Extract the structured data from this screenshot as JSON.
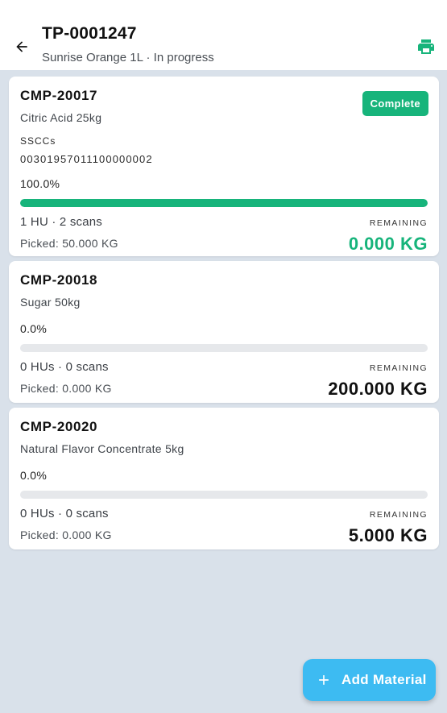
{
  "header": {
    "title": "TP-0001247",
    "subtitle": "Sunrise Orange 1L · In progress",
    "back_icon": "arrow-left-icon",
    "print_icon": "printer-icon"
  },
  "colors": {
    "accent_green": "#17b47b",
    "fab_blue": "#3dbbf2",
    "background": "#d9e1ea"
  },
  "materials": [
    {
      "code": "CMP-20017",
      "name": "Citric Acid 25kg",
      "badge": "Complete",
      "ssccs_label": "SSCCs",
      "sscc": "00301957011100000002",
      "percent_label": "100.0%",
      "progress": 1.0,
      "hu_scans": "1 HU · 2 scans",
      "picked": "Picked: 50.000 KG",
      "remaining_label": "REMAINING",
      "remaining_value": "0.000 KG"
    },
    {
      "code": "CMP-20018",
      "name": "Sugar 50kg",
      "percent_label": "0.0%",
      "progress": 0.0,
      "hu_scans": "0 HUs · 0 scans",
      "picked": "Picked: 0.000 KG",
      "remaining_label": "REMAINING",
      "remaining_value": "200.000 KG"
    },
    {
      "code": "CMP-20020",
      "name": "Natural Flavor Concentrate 5kg",
      "percent_label": "0.0%",
      "progress": 0.0,
      "hu_scans": "0 HUs · 0 scans",
      "picked": "Picked: 0.000 KG",
      "remaining_label": "REMAINING",
      "remaining_value": "5.000 KG"
    }
  ],
  "fab": {
    "label": "Add Material",
    "icon": "plus-icon"
  }
}
